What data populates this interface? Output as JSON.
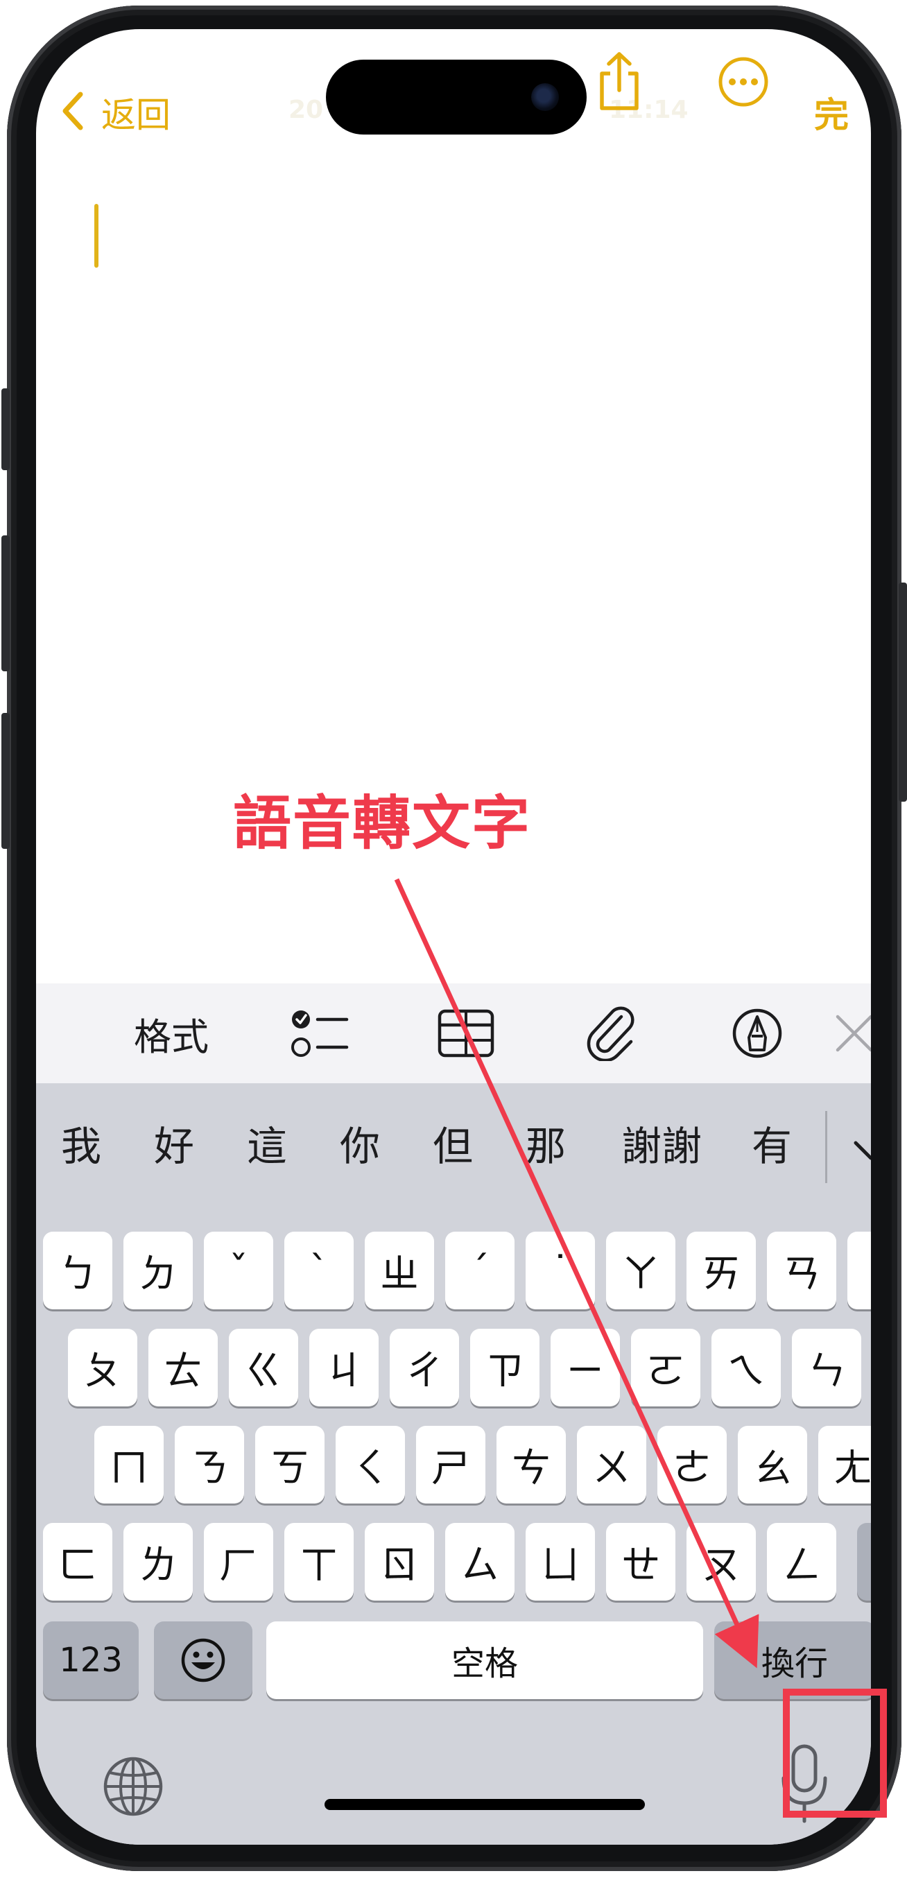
{
  "nav": {
    "back_label": "返回",
    "done_label": "完"
  },
  "status_bar": {
    "left_time": "20",
    "right_time": "11:14"
  },
  "annotation": {
    "text": "語音轉文字",
    "color": "#ef3a4b"
  },
  "toolbar": {
    "format_label": "格式"
  },
  "suggestions": [
    "我",
    "好",
    "這",
    "你",
    "但",
    "那",
    "謝謝",
    "有"
  ],
  "keyboard": {
    "row1": [
      "ㄅ",
      "ㄉ",
      "ˇ",
      "ˋ",
      "ㄓ",
      "ˊ",
      "˙",
      "ㄚ",
      "ㄞ",
      "ㄢ"
    ],
    "row2": [
      "ㄆ",
      "ㄊ",
      "ㄍ",
      "ㄐ",
      "ㄔ",
      "ㄗ",
      "ㄧ",
      "ㄛ",
      "ㄟ",
      "ㄣ"
    ],
    "row3": [
      "ㄇ",
      "ㄋ",
      "ㄎ",
      "ㄑ",
      "ㄕ",
      "ㄘ",
      "ㄨ",
      "ㄜ",
      "ㄠ",
      "ㄤ"
    ],
    "row4": [
      "ㄈ",
      "ㄌ",
      "ㄏ",
      "ㄒ",
      "ㄖ",
      "ㄙ",
      "ㄩ",
      "ㄝ",
      "ㄡ",
      "ㄥ"
    ],
    "numbers_label": "123",
    "space_label": "空格",
    "return_label": "換行"
  },
  "colors": {
    "accent": "#e5ad0d",
    "annotation_red": "#ef3a4b",
    "keyboard_bg": "#d1d3da"
  }
}
